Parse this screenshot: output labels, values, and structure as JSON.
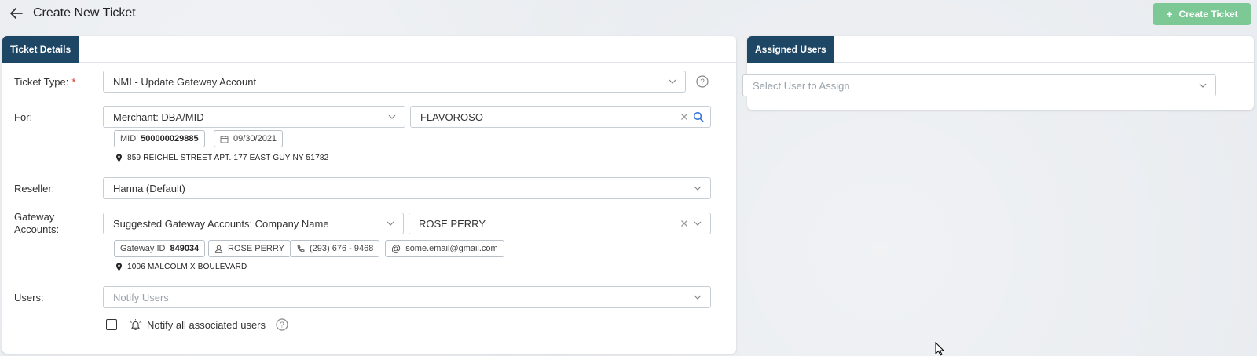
{
  "header": {
    "title": "Create New Ticket",
    "create_button_label": "Create Ticket"
  },
  "ticket_details": {
    "tab_label": "Ticket Details",
    "ticket_type": {
      "label": "Ticket Type:",
      "required_mark": "*",
      "value": "NMI - Update Gateway Account"
    },
    "for": {
      "label": "For:",
      "type_value": "Merchant: DBA/MID",
      "search_value": "FLAVOROSO",
      "mid_prefix": "MID",
      "mid_value": "500000029885",
      "date": "09/30/2021",
      "address": "859 REICHEL STREET APT. 177 EAST GUY NY 51782"
    },
    "reseller": {
      "label": "Reseller:",
      "value": "Hanna (Default)"
    },
    "gateway_accounts": {
      "label_line1": "Gateway",
      "label_line2": "Accounts:",
      "suggestion_value": "Suggested Gateway Accounts: Company Name",
      "account_value": "ROSE PERRY",
      "gateway_id_prefix": "Gateway ID",
      "gateway_id_value": "849034",
      "contact_name": "ROSE PERRY",
      "phone": "(293) 676 - 9468",
      "email": "some.email@gmail.com",
      "address": "1006 MALCOLM X BOULEVARD"
    },
    "users": {
      "label": "Users:",
      "placeholder": "Notify Users",
      "notify_all_label": "Notify all associated users"
    }
  },
  "assigned_users": {
    "tab_label": "Assigned Users",
    "placeholder": "Select User to Assign"
  },
  "colors": {
    "tab_bg": "#1e4766",
    "create_button_bg": "#7cc996",
    "required": "#d0342c"
  },
  "icons": [
    "back-arrow-icon",
    "plus-icon",
    "chevron-down-icon",
    "help-icon",
    "clear-icon",
    "search-icon",
    "calendar-icon",
    "map-pin-icon",
    "user-icon",
    "phone-icon",
    "at-icon",
    "bell-icon",
    "mouse-cursor-icon"
  ]
}
